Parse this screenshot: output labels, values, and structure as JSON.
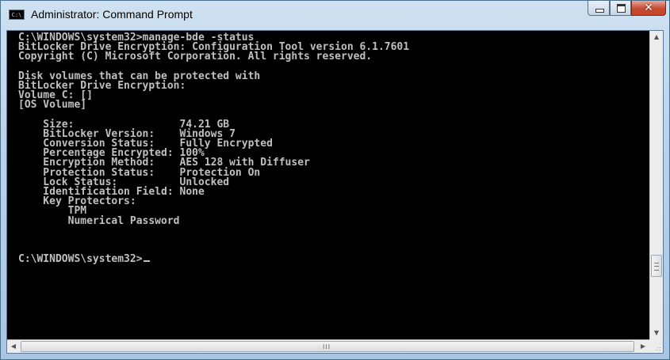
{
  "window": {
    "title": "Administrator: Command Prompt",
    "icon_label": "C:\\",
    "buttons": {
      "minimize_icon": "minimize-icon",
      "maximize_icon": "maximize-icon",
      "close_icon": "close-icon",
      "close_glyph": "✕"
    }
  },
  "console": {
    "lines": [
      "C:\\WINDOWS\\system32>manage-bde -status",
      "BitLocker Drive Encryption: Configuration Tool version 6.1.7601",
      "Copyright (C) Microsoft Corporation. All rights reserved.",
      "",
      "Disk volumes that can be protected with",
      "BitLocker Drive Encryption:",
      "Volume C: []",
      "[OS Volume]",
      "",
      "    Size:                 74.21 GB",
      "    BitLocker Version:    Windows 7",
      "    Conversion Status:    Fully Encrypted",
      "    Percentage Encrypted: 100%",
      "    Encryption Method:    AES 128 with Diffuser",
      "    Protection Status:    Protection On",
      "    Lock Status:          Unlocked",
      "    Identification Field: None",
      "    Key Protectors:",
      "        TPM",
      "        Numerical Password",
      "",
      "",
      ""
    ],
    "prompt": "C:\\WINDOWS\\system32>"
  },
  "scrollbars": {
    "up_arrow": "▲",
    "down_arrow": "▼",
    "left_arrow": "◀",
    "right_arrow": "▶",
    "h_grip": "III",
    "size_grip": ".::"
  },
  "colors": {
    "console_bg": "#000000",
    "console_fg": "#c0c0c0",
    "close_button": "#c7452a"
  }
}
